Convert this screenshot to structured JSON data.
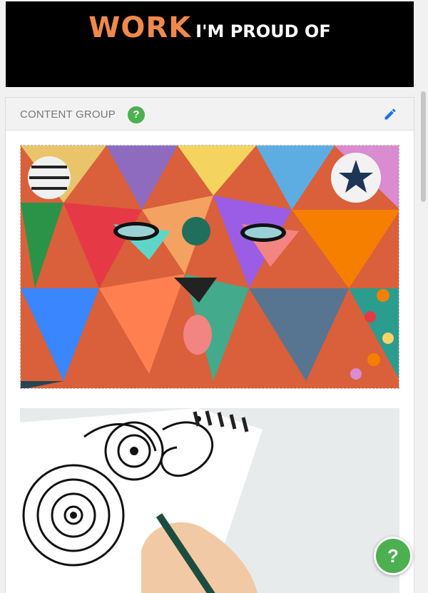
{
  "banner": {
    "title_accent": "WORK",
    "title_rest": "I'M PROUD OF"
  },
  "card": {
    "title": "CONTENT GROUP",
    "help_glyph": "?"
  },
  "icons": {
    "edit": "pencil-icon",
    "help": "question-icon"
  },
  "images": [
    {
      "name": "geometric-bear-mural-image"
    },
    {
      "name": "mandala-drawing-sketchbook-image"
    }
  ],
  "fab": {
    "glyph": "?"
  },
  "colors": {
    "accent": "#f08a4b",
    "help_green": "#4caf50",
    "edit_blue": "#1a73e8"
  }
}
